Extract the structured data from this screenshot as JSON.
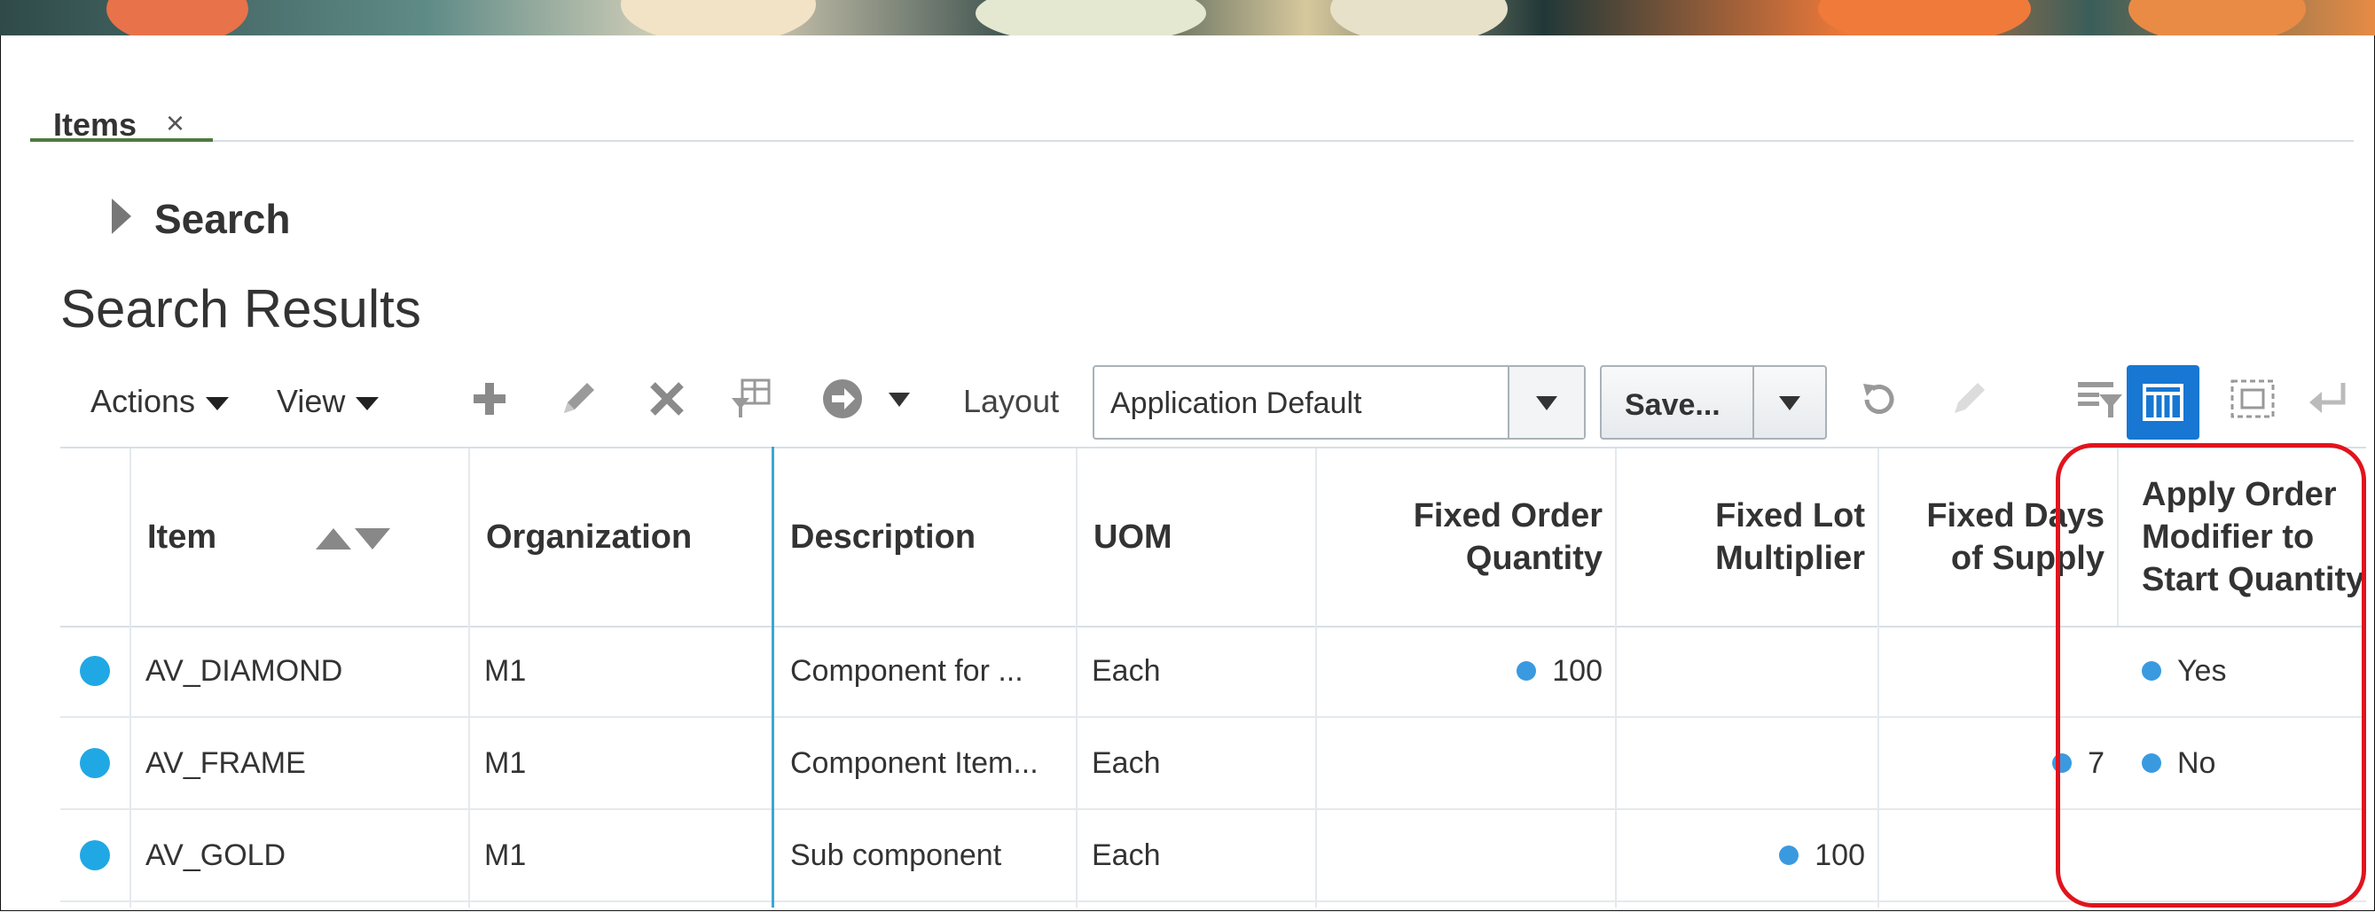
{
  "tabs": [
    {
      "label": "Items",
      "close": "×"
    }
  ],
  "search": {
    "label": "Search"
  },
  "results": {
    "title": "Search Results"
  },
  "toolbar": {
    "actions_label": "Actions",
    "view_label": "View",
    "layout_label": "Layout",
    "layout_value": "Application Default",
    "save_label": "Save..."
  },
  "table": {
    "columns": {
      "item": "Item",
      "organization": "Organization",
      "description": "Description",
      "uom": "UOM",
      "fixed_order_quantity": "Fixed Order Quantity",
      "fixed_lot_multiplier": "Fixed Lot Multiplier",
      "fixed_days_of_supply": "Fixed Days of Supply",
      "apply_order_modifier": "Apply Order Modifier to Start Quantity"
    },
    "rows": [
      {
        "item": "AV_DIAMOND",
        "organization": "M1",
        "description": "Component for ...",
        "uom": "Each",
        "fixed_order_quantity": "100",
        "fixed_lot_multiplier": "",
        "fixed_days_of_supply": "",
        "apply_order_modifier": "Yes"
      },
      {
        "item": "AV_FRAME",
        "organization": "M1",
        "description": "Component Item...",
        "uom": "Each",
        "fixed_order_quantity": "",
        "fixed_lot_multiplier": "",
        "fixed_days_of_supply": "7",
        "apply_order_modifier": "No"
      },
      {
        "item": "AV_GOLD",
        "organization": "M1",
        "description": "Sub component",
        "uom": "Each",
        "fixed_order_quantity": "",
        "fixed_lot_multiplier": "100",
        "fixed_days_of_supply": "",
        "apply_order_modifier": ""
      }
    ]
  },
  "colors": {
    "accent": "#1777d2",
    "row_status": "#20a8e4",
    "highlight": "#e0141e",
    "tab_underline": "#4f7a3f"
  }
}
